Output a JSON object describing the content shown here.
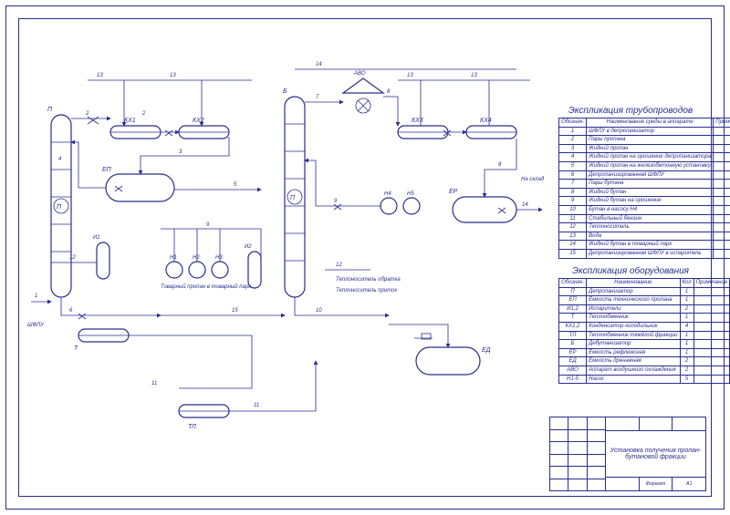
{
  "titles": {
    "pipes": "Экспликация трубопроводов",
    "equipment": "Экспликация оборудования"
  },
  "pipes": {
    "headers": [
      "Обознач.",
      "Наименование среды в аппарате",
      "Примечание"
    ],
    "rows": [
      {
        "n": "1",
        "name": "ШФЛУ в депропанизатор",
        "note": ""
      },
      {
        "n": "2",
        "name": "Пары пропана",
        "note": ""
      },
      {
        "n": "3",
        "name": "Жидкий пропан",
        "note": ""
      },
      {
        "n": "4",
        "name": "Жидкий пропан на орошение депропанизатора",
        "note": ""
      },
      {
        "n": "5",
        "name": "Жидкий пропан на железобетонную установку",
        "note": ""
      },
      {
        "n": "6",
        "name": "Депропанизированная ШФЛУ",
        "note": ""
      },
      {
        "n": "7",
        "name": "Пары бутана",
        "note": ""
      },
      {
        "n": "8",
        "name": "Жидкий бутан",
        "note": ""
      },
      {
        "n": "9",
        "name": "Жидкий бутан на орошение",
        "note": ""
      },
      {
        "n": "10",
        "name": "Бутан в насосу Н4",
        "note": ""
      },
      {
        "n": "11",
        "name": "Стабильный бензин",
        "note": ""
      },
      {
        "n": "12",
        "name": "Теплоноситель",
        "note": ""
      },
      {
        "n": "13",
        "name": "Вода",
        "note": ""
      },
      {
        "n": "14",
        "name": "Жидкий бутан в товарный парк",
        "note": ""
      },
      {
        "n": "15",
        "name": "Депропанизированная ШФЛУ в испаритель",
        "note": ""
      }
    ]
  },
  "equipment": {
    "headers": [
      "Обознач.",
      "Наименование",
      "Кол",
      "Примечание"
    ],
    "rows": [
      {
        "n": "П",
        "name": "Депропанизатор",
        "q": "1",
        "note": ""
      },
      {
        "n": "ЕП",
        "name": "Ёмкость технического пропана",
        "q": "1",
        "note": ""
      },
      {
        "n": "И1,2",
        "name": "Испарители",
        "q": "2",
        "note": ""
      },
      {
        "n": "Т",
        "name": "Теплообменник",
        "q": "1",
        "note": ""
      },
      {
        "n": "КХ1,2",
        "name": "Конденсатор-холодильник",
        "q": "4",
        "note": ""
      },
      {
        "n": "ТЛ",
        "name": "Теплообменник тяжёлой фракции",
        "q": "1",
        "note": ""
      },
      {
        "n": "Б",
        "name": "Дебутанизатор",
        "q": "1",
        "note": ""
      },
      {
        "n": "ЕР",
        "name": "Ёмкость рефлюксная",
        "q": "1",
        "note": ""
      },
      {
        "n": "ЕД",
        "name": "Ёмкость дренажная",
        "q": "2",
        "note": ""
      },
      {
        "n": "АВО",
        "name": "Аппарат воздушного охлаждения",
        "q": "2",
        "note": ""
      },
      {
        "n": "Н1-5",
        "name": "Насос",
        "q": "5",
        "note": ""
      }
    ]
  },
  "titleblock": {
    "project": "Установка получения пропан-бутановой фракции",
    "sheet_label": "Формат",
    "format": "А1"
  },
  "tags": {
    "P": "П",
    "EP": "ЕП",
    "I1": "И1",
    "I2": "И2",
    "KX1": "КХ1",
    "KX2": "КХ2",
    "KX3": "КХ3",
    "KX4": "КХ4",
    "T": "Т",
    "TL": "ТЛ",
    "B": "Б",
    "ER": "ЕР",
    "ED": "ЕД",
    "AVO": "АВО",
    "AVO2": "АВО",
    "N1": "Н1",
    "N2": "Н2",
    "N3": "Н3",
    "N4": "Н4",
    "N5": "Н5",
    "to_park": "На склад",
    "shflu": "ШФЛУ",
    "note_park": "Товарный пропан в товарный парк",
    "note_tb": "Теплоноситель обратка",
    "note_tp": "Теплоноситель приток"
  },
  "line_numbers": [
    "1",
    "2",
    "3",
    "4",
    "5",
    "6",
    "7",
    "8",
    "9",
    "10",
    "11",
    "12",
    "13",
    "14",
    "15"
  ]
}
